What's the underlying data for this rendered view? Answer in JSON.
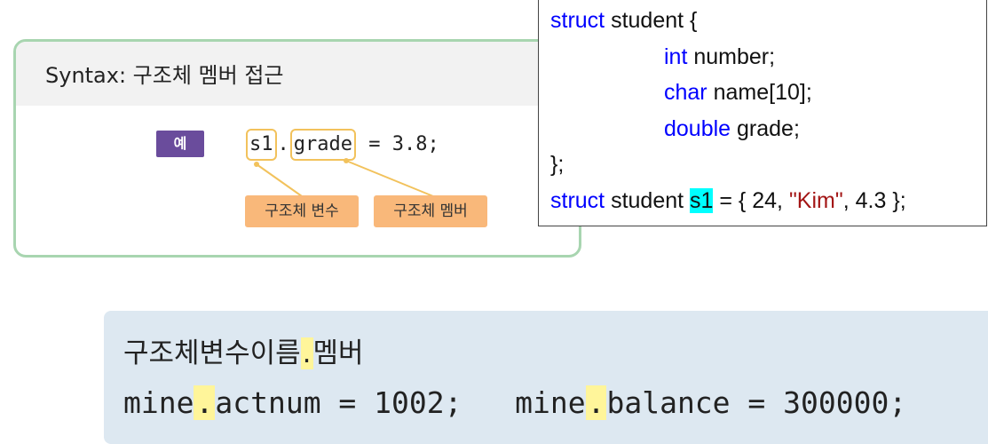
{
  "syntax_box": {
    "title": "Syntax:  구조체  멤버  접근",
    "example_badge": "예",
    "example": {
      "var": "s1",
      "dot": ".",
      "member": "grade",
      "rest": " = 3.8;"
    },
    "tag_variable": "구조체 변수",
    "tag_member": "구조체 멤버"
  },
  "struct_code": {
    "line1": {
      "kw": "struct",
      "rest": " student {"
    },
    "line2": {
      "kw": "int",
      "rest": " number;"
    },
    "line3": {
      "kw": "char",
      "rest": " name[10];"
    },
    "line4": {
      "kw": "double",
      "rest": " grade;"
    },
    "line5": "};",
    "line6": {
      "kw": "struct",
      "mid": " student ",
      "var": "s1",
      "eq": " = { 24, ",
      "str": "\"Kim\"",
      "end": ", 4.3 };"
    }
  },
  "access_box": {
    "line1_a": "구조체변수이름",
    "line1_dot": ".",
    "line1_b": "멤버",
    "line2_a": "mine",
    "line2_dot1": ".",
    "line2_b": "actnum = 1002;   mine",
    "line2_dot2": ".",
    "line2_c": "balance = 300000;"
  },
  "colors": {
    "syntax_border": "#a8d5b0",
    "badge": "#6a4c9c",
    "tag": "#f9b87a",
    "callout": "#f2c25c",
    "keyword": "#0000ff",
    "string": "#a31515",
    "var_highlight": "#00ffff",
    "access_bg": "#dde8f1",
    "dot_highlight": "#fff59a"
  }
}
